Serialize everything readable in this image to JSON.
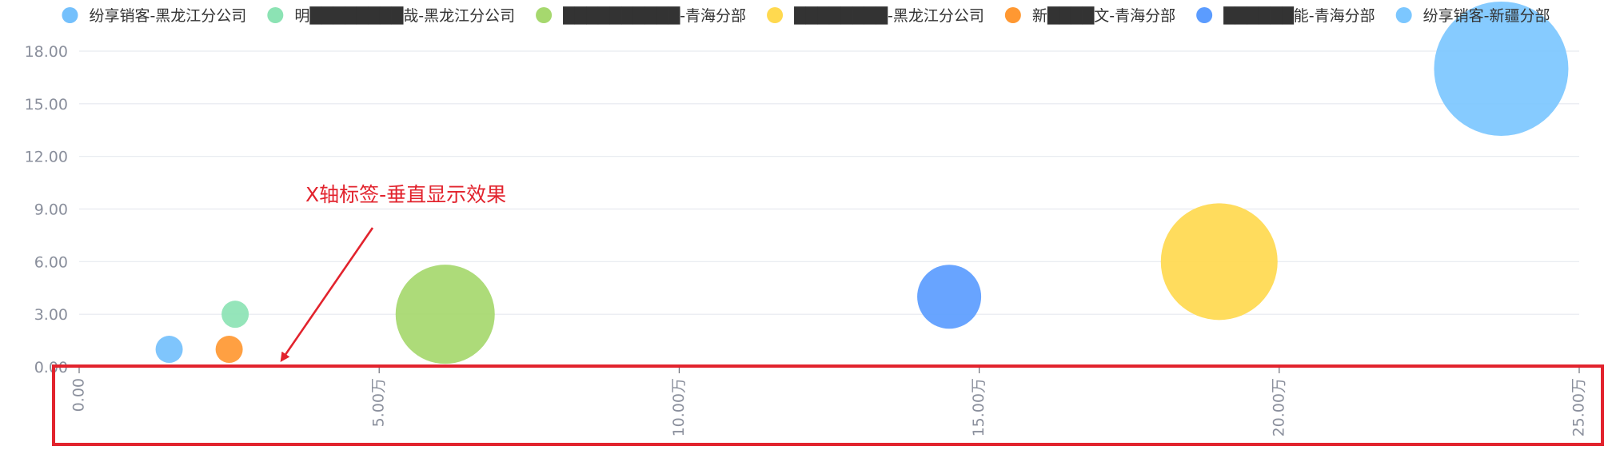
{
  "chart_data": {
    "type": "scatter",
    "subtype": "bubble",
    "title": "",
    "xlabel": "",
    "ylabel": "",
    "xlim": [
      0,
      250000
    ],
    "ylim": [
      0,
      18
    ],
    "x_ticks": [
      "0.00",
      "5.00万",
      "10.00万",
      "15.00万",
      "20.00万",
      "25.00万"
    ],
    "x_tick_values": [
      0,
      50000,
      100000,
      150000,
      200000,
      250000
    ],
    "x_tick_label_rotation": "vertical",
    "y_ticks": [
      "0.00",
      "3.00",
      "6.00",
      "9.00",
      "12.00",
      "15.00",
      "18.00"
    ],
    "y_tick_values": [
      0,
      3,
      6,
      9,
      12,
      15,
      18
    ],
    "grid": true,
    "legend_position": "top",
    "series": [
      {
        "name": "纷享销客-黑龙江分公司",
        "color": "#74c0fc",
        "points": [
          {
            "x": 15000,
            "y": 1,
            "size": 17
          }
        ]
      },
      {
        "name": "明████████哉-黑龙江分公司",
        "color": "#8ce3b4",
        "points": [
          {
            "x": 26000,
            "y": 3,
            "size": 17
          }
        ]
      },
      {
        "name": "██████████-青海分部",
        "color": "#a6d86e",
        "points": [
          {
            "x": 61000,
            "y": 3,
            "size": 62
          }
        ]
      },
      {
        "name": "████████-黑龙江分公司",
        "color": "#ffd94f",
        "points": [
          {
            "x": 190000,
            "y": 6,
            "size": 73
          }
        ]
      },
      {
        "name": "新████文-青海分部",
        "color": "#ff9832",
        "points": [
          {
            "x": 25000,
            "y": 1,
            "size": 17
          }
        ]
      },
      {
        "name": "██████能-青海分部",
        "color": "#5b9cff",
        "points": [
          {
            "x": 145000,
            "y": 4,
            "size": 40
          }
        ]
      },
      {
        "name": "纷享销客-新疆分部",
        "color": "#7cc7ff",
        "points": [
          {
            "x": 237000,
            "y": 17,
            "size": 84
          }
        ]
      }
    ],
    "annotations": [
      {
        "text": "X轴标签-垂直显示效果",
        "color": "#e2232d"
      }
    ]
  }
}
